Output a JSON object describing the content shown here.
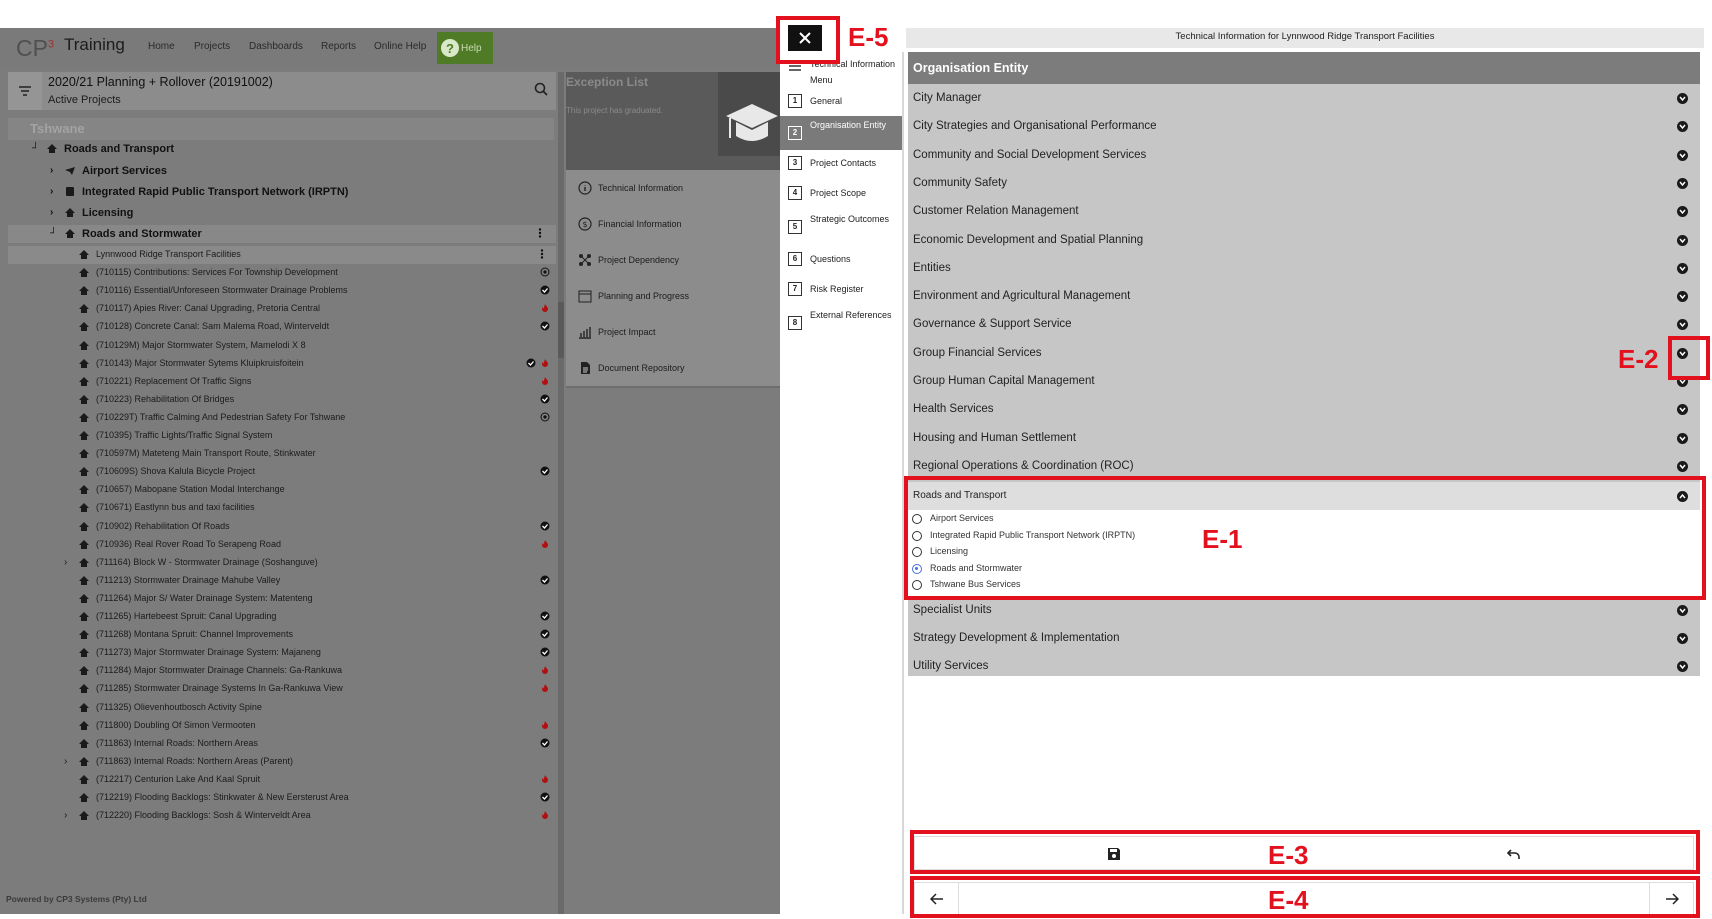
{
  "app": {
    "logo_text": "CP",
    "logo_sup": "3",
    "brand": "Training",
    "nav": [
      "Home",
      "Projects",
      "Dashboards",
      "Reports",
      "Online Help"
    ],
    "help_label": "Help",
    "project_title": "2020/21 Planning + Rollover (20191002)",
    "project_subtitle": "Active Projects",
    "tree_root": "Tshwane",
    "footer": "Powered by CP3 Systems (Pty) Ltd"
  },
  "tree": {
    "department": "Roads and Transport",
    "subgroups": [
      "Airport Services",
      "Integrated Rapid Public Transport Network (IRPTN)",
      "Licensing",
      "Roads and Stormwater"
    ],
    "projects": [
      {
        "label": "Lynnwood Ridge Transport Facilities",
        "status": "kebab"
      },
      {
        "label": "(710115) Contributions: Services For Township Development",
        "status": "target"
      },
      {
        "label": "(710116) Essential/Unforeseen Stormwater Drainage Problems",
        "status": "check"
      },
      {
        "label": "(710117) Apies River: Canal Upgrading, Pretoria Central",
        "status": "fire"
      },
      {
        "label": "(710128) Concrete Canal: Sam Malema Road, Winterveldt",
        "status": "check"
      },
      {
        "label": "(710129M) Major Stormwater System, Mamelodi X 8",
        "status": ""
      },
      {
        "label": "(710143) Major Stormwater Sytems Kluipkruisfoitein",
        "status": "check-fire"
      },
      {
        "label": "(710221) Replacement Of Traffic Signs",
        "status": "fire"
      },
      {
        "label": "(710223) Rehabilitation Of Bridges",
        "status": "check"
      },
      {
        "label": "(710229T) Traffic Calming And Pedestrian Safety For Tshwane",
        "status": "target"
      },
      {
        "label": "(710395) Traffic Lights/Traffic Signal System",
        "status": ""
      },
      {
        "label": "(710597M) Mateteng Main Transport Route, Stinkwater",
        "status": ""
      },
      {
        "label": "(710609S) Shova Kalula Bicycle Project",
        "status": "check"
      },
      {
        "label": "(710657) Mabopane Station Modal Interchange",
        "status": ""
      },
      {
        "label": "(710671) Eastlynn bus and taxi facilities",
        "status": ""
      },
      {
        "label": "(710902) Rehabilitation Of Roads",
        "status": "check"
      },
      {
        "label": "(710936) Real Rover Road To Serapeng Road",
        "status": "fire"
      },
      {
        "label": "(711164) Block W - Stormwater Drainage (Soshanguve)",
        "status": "",
        "expandable": true
      },
      {
        "label": "(711213) Stormwater Drainage Mahube Valley",
        "status": "check"
      },
      {
        "label": "(711264) Major S/ Water Drainage System: Matenteng",
        "status": ""
      },
      {
        "label": "(711265) Hartebeest Spruit: Canal Upgrading",
        "status": "check"
      },
      {
        "label": "(711268) Montana Spruit: Channel Improvements",
        "status": "check"
      },
      {
        "label": "(711273) Major Stormwater Drainage System: Majaneng",
        "status": "check"
      },
      {
        "label": "(711284) Major Stormwater Drainage Channels: Ga-Rankuwa",
        "status": "fire"
      },
      {
        "label": "(711285) Stormwater Drainage Systems In Ga-Rankuwa View",
        "status": "fire"
      },
      {
        "label": "(711325) Olievenhoutbosch Activity Spine",
        "status": ""
      },
      {
        "label": "(711800) Doubling Of Simon Vermooten",
        "status": "fire"
      },
      {
        "label": "(711863) Internal Roads: Northern Areas",
        "status": "check"
      },
      {
        "label": "(711863) Internal Roads: Northern Areas (Parent)",
        "status": "",
        "expandable": true
      },
      {
        "label": "(712217) Centurion Lake And Kaal Spruit",
        "status": "fire"
      },
      {
        "label": "(712219) Flooding Backlogs: Stinkwater & New Eersterust Area",
        "status": "check"
      },
      {
        "label": "(712220) Flooding Backlogs: Sosh & Winterveldt Area",
        "status": "fire",
        "expandable": true
      }
    ]
  },
  "exception": {
    "title": "Exception List",
    "subtitle": "This project has graduated."
  },
  "info_menu": [
    {
      "label": "Technical Information",
      "icon": "info-icon"
    },
    {
      "label": "Financial Information",
      "icon": "dollar-icon"
    },
    {
      "label": "Project Dependency",
      "icon": "dependency-icon"
    },
    {
      "label": "Planning and Progress",
      "icon": "calendar-icon"
    },
    {
      "label": "Project Impact",
      "icon": "impact-chart-icon"
    },
    {
      "label": "Document Repository",
      "icon": "document-icon"
    }
  ],
  "side_menu": {
    "menu_label": "Technical Information Menu",
    "items": [
      {
        "num": "1",
        "label": "General"
      },
      {
        "num": "2",
        "label": "Organisation Entity",
        "active": true
      },
      {
        "num": "3",
        "label": "Project Contacts"
      },
      {
        "num": "4",
        "label": "Project Scope"
      },
      {
        "num": "5",
        "label": "Strategic Outcomes"
      },
      {
        "num": "6",
        "label": "Questions"
      },
      {
        "num": "7",
        "label": "Risk Register"
      },
      {
        "num": "8",
        "label": "External References"
      }
    ]
  },
  "panel": {
    "title": "Technical Information for Lynnwood Ridge Transport Facilities",
    "section_title": "Organisation Entity",
    "entities_before": [
      "City Manager",
      "City Strategies and Organisational Performance",
      "Community and Social Development Services",
      "Community Safety",
      "Customer Relation Management",
      "Economic Development and Spatial Planning",
      "Entities",
      "Environment and Agricultural Management",
      "Governance & Support Service",
      "Group Financial Services",
      "Group Human Capital Management",
      "Health Services",
      "Housing and Human Settlement",
      "Regional Operations & Coordination (ROC)"
    ],
    "expanded": {
      "label": "Roads and Transport",
      "options": [
        "Airport Services",
        "Integrated Rapid Public Transport Network (IRPTN)",
        "Licensing",
        "Roads and Stormwater",
        "Tshwane Bus Services"
      ],
      "selected": "Roads and Stormwater"
    },
    "entities_after": [
      "Specialist Units",
      "Strategy Development & Implementation",
      "Utility Services"
    ]
  },
  "annotations": [
    "E-1",
    "E-2",
    "E-3",
    "E-4",
    "E-5"
  ],
  "colors": {
    "annotation": "#e3101d",
    "radio_selected": "#4a6fe0",
    "help_button": "#4f7b27"
  }
}
